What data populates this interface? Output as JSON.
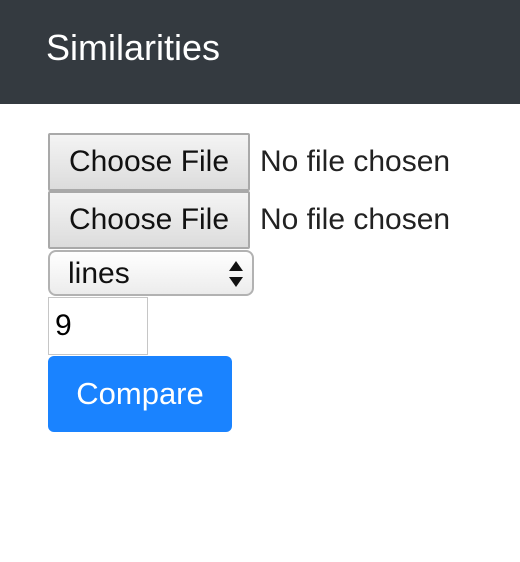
{
  "navbar": {
    "brand": "Similarities"
  },
  "form": {
    "file1": {
      "button_label": "Choose File",
      "status": "No file chosen"
    },
    "file2": {
      "button_label": "Choose File",
      "status": "No file chosen"
    },
    "mode_select": {
      "selected": "lines"
    },
    "threshold_input": {
      "value": "9"
    },
    "submit_label": "Compare"
  },
  "colors": {
    "navbar_bg": "#343a40",
    "primary": "#1a83ff"
  }
}
